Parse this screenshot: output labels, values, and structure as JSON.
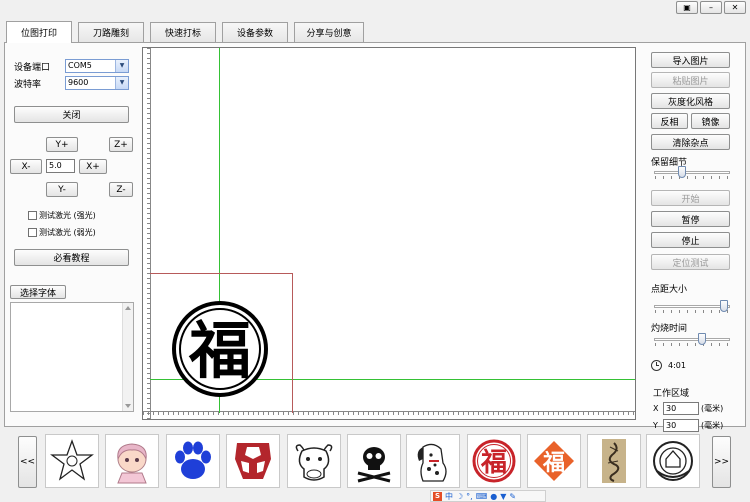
{
  "window": {
    "controls": [
      "▣",
      "–",
      "✕"
    ]
  },
  "tabs": [
    {
      "label": "位图打印",
      "active": true
    },
    {
      "label": "刀路雕刻",
      "active": false
    },
    {
      "label": "快速打标",
      "active": false
    },
    {
      "label": "设备参数",
      "active": false
    },
    {
      "label": "分享与创意",
      "active": false
    }
  ],
  "left": {
    "port_label": "设备端口",
    "port_value": "COM5",
    "baud_label": "波特率",
    "baud_value": "9600",
    "close_btn": "关闭",
    "y_plus": "Y+",
    "y_minus": "Y-",
    "z_plus": "Z+",
    "z_minus": "Z-",
    "x_minus": "X-",
    "x_plus": "X+",
    "step_value": "5.0",
    "test_strong": "测试激光 (强光)",
    "test_weak": "测试激光 (弱光)",
    "tutorial_btn": "必看教程",
    "font_btn": "选择字体"
  },
  "right": {
    "import_btn": "导入图片",
    "paste_btn": "粘贴图片",
    "gray_btn": "灰度化风格",
    "invert_btn": "反相",
    "mirror_btn": "镜像",
    "clean_btn": "清除杂点",
    "detail_label": "保留细节",
    "detail_level": 0.35,
    "start_btn": "开始",
    "pause_btn": "暂停",
    "stop_btn": "停止",
    "locate_btn": "定位测试",
    "dot_label": "点距大小",
    "dot_level": 0.97,
    "burn_label": "灼烧时间",
    "burn_level": 0.65,
    "time_value": "4:01",
    "area_label": "工作区域",
    "x_label": "X",
    "x_value": "30",
    "x_unit": "(毫米)",
    "y_label": "Y",
    "y_value": "30",
    "y_unit": "(毫米)"
  },
  "canvas": {
    "fu_char": "福"
  },
  "gallery": {
    "prev": "<<",
    "next": ">>",
    "items": [
      "star-sketch",
      "cartoon-girl",
      "paw-print",
      "robot-emblem",
      "cow-head",
      "skull-crossbones",
      "dalmatian",
      "fu-seal",
      "fu-diamond",
      "dragon-scroll",
      "badge-emblem"
    ],
    "fu_char": "福"
  },
  "ime": {
    "s_label": "S",
    "lang": "中"
  },
  "colors": {
    "accent_green": "#35c135",
    "frame_red": "#b75a5a",
    "seal_red": "#c8242a",
    "diamond_orange": "#e9622a"
  }
}
